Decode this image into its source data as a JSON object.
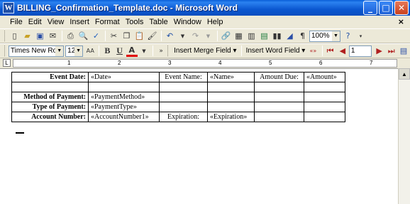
{
  "window": {
    "title": "BILLING_Confirmation_Template.doc - Microsoft Word",
    "app_icon_letter": "W",
    "minimize": "_",
    "maximize": "□",
    "close": "✕"
  },
  "menu": {
    "items": [
      "File",
      "Edit",
      "View",
      "Insert",
      "Format",
      "Tools",
      "Table",
      "Window",
      "Help"
    ],
    "close_doc": "×"
  },
  "standard_toolbar": {
    "zoom": "100%",
    "icons": [
      "new-icon",
      "open-icon",
      "save-icon",
      "permission-icon",
      "print-icon",
      "print-preview-icon",
      "spelling-icon",
      "cut-icon",
      "copy-icon",
      "paste-icon",
      "format-painter-icon",
      "undo-icon",
      "redo-icon",
      "insert-hyperlink-icon",
      "tables-borders-icon",
      "insert-table-icon",
      "insert-excel-icon",
      "columns-icon",
      "drawing-icon",
      "show-hide-icon",
      "help-icon"
    ]
  },
  "formatting_toolbar": {
    "font": "Times New Roman",
    "size": "12",
    "grow_font": "AA",
    "bold": "B",
    "underline": "U",
    "font_color": "A",
    "insert_merge_field": "Insert Merge Field",
    "insert_word_field": "Insert Word Field",
    "record_number": "1"
  },
  "ruler": {
    "tab_selector": "L",
    "numbers": [
      "1",
      "2",
      "3",
      "4",
      "5",
      "6",
      "7"
    ]
  },
  "table": {
    "rows": [
      [
        "Event Date:",
        "«Date»",
        "Event Name:",
        "«Name»",
        "Amount Due:",
        "«Amount»"
      ],
      [
        "",
        "",
        "",
        "",
        "",
        ""
      ],
      [
        "Method of Payment:",
        "«PaymentMethod»",
        "",
        "",
        "",
        ""
      ],
      [
        "Type of Payment:",
        "«PaymentType»",
        "",
        "",
        "",
        ""
      ],
      [
        "Account Number:",
        "«AccountNumber1»",
        "Expiration:",
        "«Expiration»",
        "",
        ""
      ]
    ]
  },
  "colors": {
    "titlebar": "#0a5fd8",
    "chrome": "#ece9d8",
    "page": "#ffffff"
  }
}
